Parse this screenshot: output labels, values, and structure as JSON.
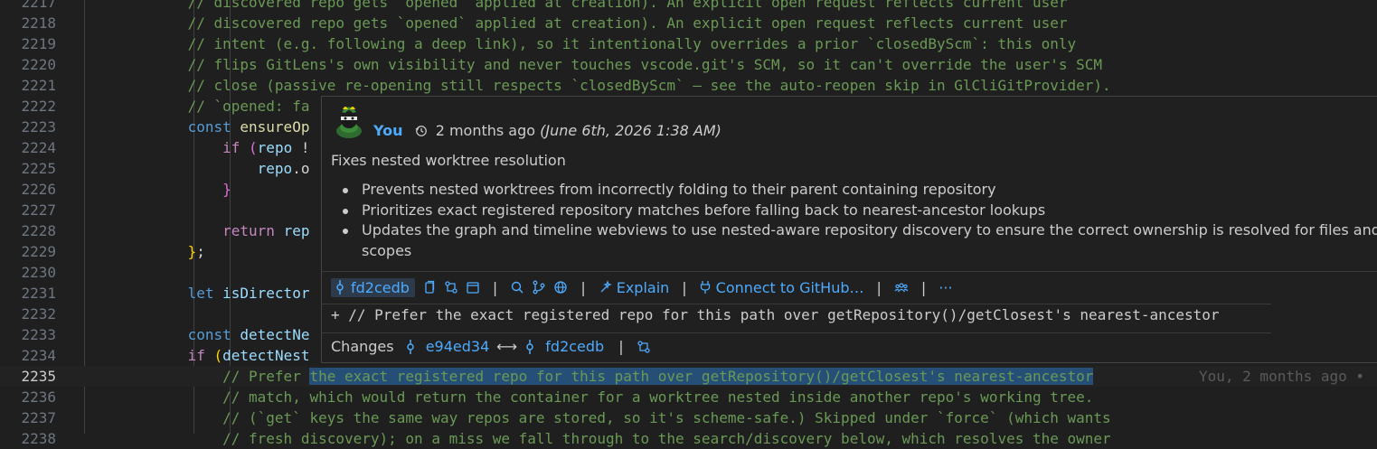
{
  "editor": {
    "lines": [
      {
        "num": "2217",
        "segments": [
          {
            "t": "            // ",
            "c": "cmt"
          },
          {
            "t": "discovered repo gets `opened` applied at creation). An explicit open request reflects current user",
            "c": "cmt"
          }
        ]
      },
      {
        "num": "2218",
        "segments": [
          {
            "t": "            // discovered repo gets `opened` applied at creation). An explicit open request reflects current user",
            "c": "cmt"
          }
        ]
      },
      {
        "num": "2219",
        "segments": [
          {
            "t": "            // intent (e.g. following a deep link), so it intentionally overrides a prior `closedByScm`: this only",
            "c": "cmt"
          }
        ]
      },
      {
        "num": "2220",
        "segments": [
          {
            "t": "            // flips GitLens's own visibility and never touches vscode.git's SCM, so it can't override the user's SCM",
            "c": "cmt"
          }
        ]
      },
      {
        "num": "2221",
        "segments": [
          {
            "t": "            // close (passive re-opening still respects `closedByScm` — see the auto-reopen skip in GlCliGitProvider).",
            "c": "cmt"
          }
        ]
      },
      {
        "num": "2222",
        "segments": [
          {
            "t": "            // `opened: fa",
            "c": "cmt"
          }
        ]
      },
      {
        "num": "2223",
        "segments": [
          {
            "t": "            ",
            "c": "pun"
          },
          {
            "t": "const ",
            "c": "kw"
          },
          {
            "t": "ensureOp",
            "c": "fn"
          }
        ]
      },
      {
        "num": "2224",
        "segments": [
          {
            "t": "                ",
            "c": "pun"
          },
          {
            "t": "if ",
            "c": "ctl"
          },
          {
            "t": "(",
            "c": "brk"
          },
          {
            "t": "repo ",
            "c": "var"
          },
          {
            "t": "!",
            "c": "pun"
          }
        ]
      },
      {
        "num": "2225",
        "segments": [
          {
            "t": "                    ",
            "c": "pun"
          },
          {
            "t": "repo",
            "c": "var"
          },
          {
            "t": ".o",
            "c": "pun"
          }
        ]
      },
      {
        "num": "2226",
        "segments": [
          {
            "t": "                ",
            "c": "pun"
          },
          {
            "t": "}",
            "c": "brk"
          }
        ]
      },
      {
        "num": "2227",
        "segments": []
      },
      {
        "num": "2228",
        "segments": [
          {
            "t": "                ",
            "c": "pun"
          },
          {
            "t": "return ",
            "c": "ctl"
          },
          {
            "t": "rep",
            "c": "var"
          }
        ]
      },
      {
        "num": "2229",
        "segments": [
          {
            "t": "            ",
            "c": "pun"
          },
          {
            "t": "}",
            "c": "brk2"
          },
          {
            "t": ";",
            "c": "pun"
          }
        ]
      },
      {
        "num": "2230",
        "segments": []
      },
      {
        "num": "2231",
        "segments": [
          {
            "t": "            ",
            "c": "pun"
          },
          {
            "t": "let ",
            "c": "kw"
          },
          {
            "t": "isDirector",
            "c": "var"
          }
        ]
      },
      {
        "num": "2232",
        "segments": []
      },
      {
        "num": "2233",
        "segments": [
          {
            "t": "            ",
            "c": "pun"
          },
          {
            "t": "const ",
            "c": "kw"
          },
          {
            "t": "detectNe",
            "c": "var"
          }
        ]
      },
      {
        "num": "2234",
        "segments": [
          {
            "t": "            ",
            "c": "pun"
          },
          {
            "t": "if ",
            "c": "ctl"
          },
          {
            "t": "(",
            "c": "brk2"
          },
          {
            "t": "detectNest",
            "c": "var"
          }
        ]
      },
      {
        "num": "2235",
        "current": true,
        "segments": [
          {
            "t": "                // Prefer ",
            "c": "cmt"
          },
          {
            "t": "the exact registered repo for this path over getRepository()/getClosest's nearest-ancestor",
            "c": "cmt hl"
          }
        ]
      },
      {
        "num": "2236",
        "segments": [
          {
            "t": "                // match, which would return the container for a worktree nested inside another repo's working tree.",
            "c": "cmt"
          }
        ]
      },
      {
        "num": "2237",
        "segments": [
          {
            "t": "                // (`get` keys the same way repos are stored, so it's scheme-safe.) Skipped under `force` (which wants",
            "c": "cmt"
          }
        ]
      },
      {
        "num": "2238",
        "segments": [
          {
            "t": "                // fresh discovery); on a miss we fall through to the search/discovery below, which resolves the owner",
            "c": "cmt"
          }
        ]
      }
    ],
    "blame_annotation": "You, 2 months ago •"
  },
  "hover": {
    "author": "You",
    "relative_time": "2 months ago",
    "absolute_time": "(June 6th, 2026 1:38 AM)",
    "summary": "Fixes nested worktree resolution",
    "bullets": [
      "Prevents nested worktrees from incorrectly folding to their parent containing repository",
      "Prioritizes exact registered repository matches before falling back to nearest-ancestor lookups",
      "Updates the graph and timeline webviews to use nested-aware repository discovery to ensure the correct ownership is resolved for files and scopes"
    ],
    "toolbar": {
      "sha": "fd2cedb",
      "explain_label": "Explain",
      "connect_label": "Connect to GitHub…",
      "more_label": "···",
      "sep": "|"
    },
    "diff_line": "+ // Prefer the exact registered repo for this path over getRepository()/getClosest's nearest-ancestor",
    "changes": {
      "label": "Changes",
      "from_sha": "e94ed34",
      "arrow": "⟷",
      "to_sha": "fd2cedb",
      "sep": "|"
    }
  },
  "colors": {
    "background": "#1f1f1f",
    "comment": "#6a9955",
    "keyword": "#569cd6",
    "link": "#4daafc"
  }
}
